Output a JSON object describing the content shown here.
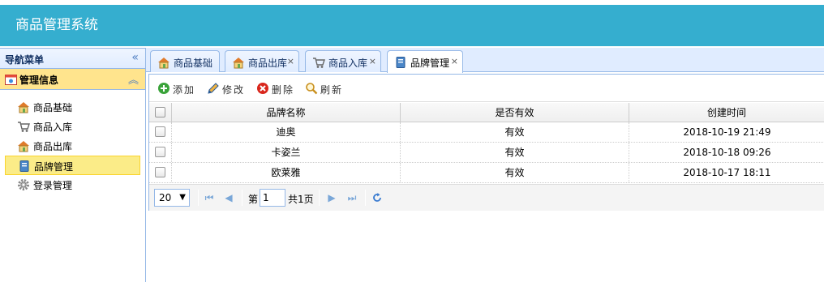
{
  "app": {
    "title": "商品管理系统"
  },
  "nav": {
    "header": "导航菜单",
    "collapse_glyph": "«",
    "group": {
      "label": "管理信息",
      "toggle_glyph": "︽"
    },
    "items": [
      {
        "label": "商品基础",
        "icon": "house-icon"
      },
      {
        "label": "商品入库",
        "icon": "cart-icon"
      },
      {
        "label": "商品出库",
        "icon": "house-icon"
      },
      {
        "label": "品牌管理",
        "icon": "book-icon",
        "active": true
      },
      {
        "label": "登录管理",
        "icon": "gear-icon"
      }
    ]
  },
  "tabs": [
    {
      "label": "商品基础",
      "icon": "house-icon",
      "closable": false
    },
    {
      "label": "商品出库",
      "icon": "house-icon",
      "closable": true
    },
    {
      "label": "商品入库",
      "icon": "cart-icon",
      "closable": true
    },
    {
      "label": "品牌管理",
      "icon": "book-icon",
      "closable": true,
      "selected": true
    }
  ],
  "tab_close_glyph": "×",
  "toolbar": {
    "add": "添加",
    "edit": "修改",
    "delete": "删除",
    "refresh": "刷新"
  },
  "grid": {
    "columns": [
      "品牌名称",
      "是否有效",
      "创建时间"
    ],
    "rows": [
      [
        "迪奥",
        "有效",
        "2018-10-19 21:49"
      ],
      [
        "卡姿兰",
        "有效",
        "2018-10-18 09:26"
      ],
      [
        "欧莱雅",
        "有效",
        "2018-10-17 18:11"
      ]
    ]
  },
  "pager": {
    "page_size": "20",
    "page_prefix": "第",
    "page_value": "1",
    "page_total": "共1页"
  },
  "colors": {
    "header": "#35aecf",
    "border": "#95b8e7",
    "active_item": "#fbec88",
    "group_header": "#ffe48d"
  }
}
